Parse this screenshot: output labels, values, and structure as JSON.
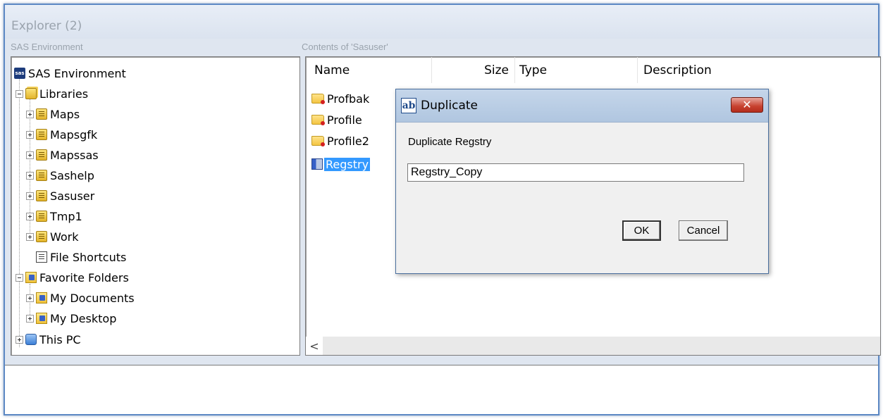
{
  "window": {
    "title": "Explorer (2)"
  },
  "tree": {
    "label": "SAS Environment",
    "items": [
      {
        "label": "SAS Environment",
        "icon": "sas-icon"
      },
      {
        "label": "Libraries",
        "icon": "libraries-icon"
      },
      {
        "label": "Maps",
        "icon": "library-icon"
      },
      {
        "label": "Mapsgfk",
        "icon": "library-icon"
      },
      {
        "label": "Mapssas",
        "icon": "library-icon"
      },
      {
        "label": "Sashelp",
        "icon": "library-icon"
      },
      {
        "label": "Sasuser",
        "icon": "library-icon"
      },
      {
        "label": "Tmp1",
        "icon": "library-icon"
      },
      {
        "label": "Work",
        "icon": "library-icon"
      },
      {
        "label": "File Shortcuts",
        "icon": "file-shortcuts-icon"
      },
      {
        "label": "Favorite Folders",
        "icon": "favorite-folders-icon"
      },
      {
        "label": "My Documents",
        "icon": "favorite-folder-icon"
      },
      {
        "label": "My Desktop",
        "icon": "favorite-folder-icon"
      },
      {
        "label": "This PC",
        "icon": "computer-icon"
      }
    ]
  },
  "contents": {
    "label": "Contents of 'Sasuser'",
    "columns": [
      "Name",
      "Size",
      "Type",
      "Description"
    ],
    "items": [
      {
        "name": "Profbak",
        "icon": "catalog-folder-icon"
      },
      {
        "name": "Profile",
        "icon": "catalog-folder-icon"
      },
      {
        "name": "Profile2",
        "icon": "catalog-folder-icon"
      },
      {
        "name": "Regstry",
        "icon": "registry-icon",
        "selected": true
      }
    ],
    "scroll_left_glyph": "<"
  },
  "dialog": {
    "title": "Duplicate",
    "icon_glyph": "ab",
    "close_glyph": "✕",
    "prompt": "Duplicate Regstry",
    "input_value": "Regstry_Copy",
    "ok_label": "OK",
    "cancel_label": "Cancel"
  }
}
